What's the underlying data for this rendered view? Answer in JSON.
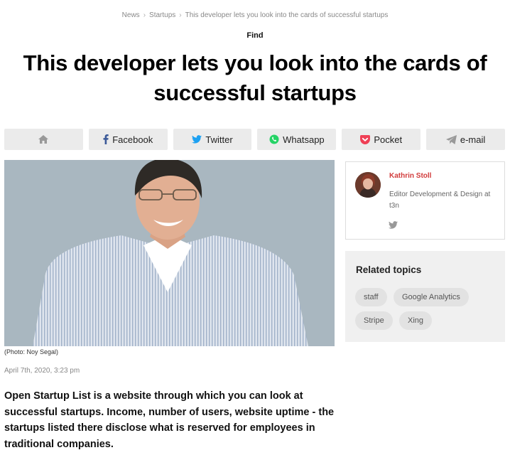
{
  "breadcrumb": {
    "items": [
      "News",
      "Startups",
      "This developer lets you look into the cards of successful startups"
    ],
    "separator": "›"
  },
  "article": {
    "kicker": "Find",
    "title": "This developer lets you look into the cards of successful startups",
    "photo_caption": "(Photo: Noy Segal)",
    "date": "April 7th, 2020, 3:23 pm",
    "lead": "Open Startup List is a website through which you can look at successful startups. Income, number of users, website uptime - the startups listed there disclose what is reserved for employees in traditional companies."
  },
  "share": {
    "buttons": [
      {
        "label": "",
        "icon": "home-icon"
      },
      {
        "label": "Facebook",
        "icon": "facebook-icon"
      },
      {
        "label": "Twitter",
        "icon": "twitter-icon"
      },
      {
        "label": "Whatsapp",
        "icon": "whatsapp-icon"
      },
      {
        "label": "Pocket",
        "icon": "pocket-icon"
      },
      {
        "label": "e-mail",
        "icon": "send-icon"
      }
    ]
  },
  "author": {
    "name": "Kathrin Stoll",
    "role": "Editor Development & Design at t3n",
    "icon": "twitter-icon"
  },
  "related": {
    "heading": "Related topics",
    "tags": [
      "staff",
      "Google Analytics",
      "Stripe",
      "Xing"
    ]
  },
  "colors": {
    "accent": "#d13a3a",
    "facebook": "#3b5998",
    "twitter": "#1da1f2",
    "whatsapp": "#25d366",
    "pocket": "#ef4056",
    "button_bg": "#ebebeb",
    "sidebar_bg": "#f0f0f0"
  }
}
